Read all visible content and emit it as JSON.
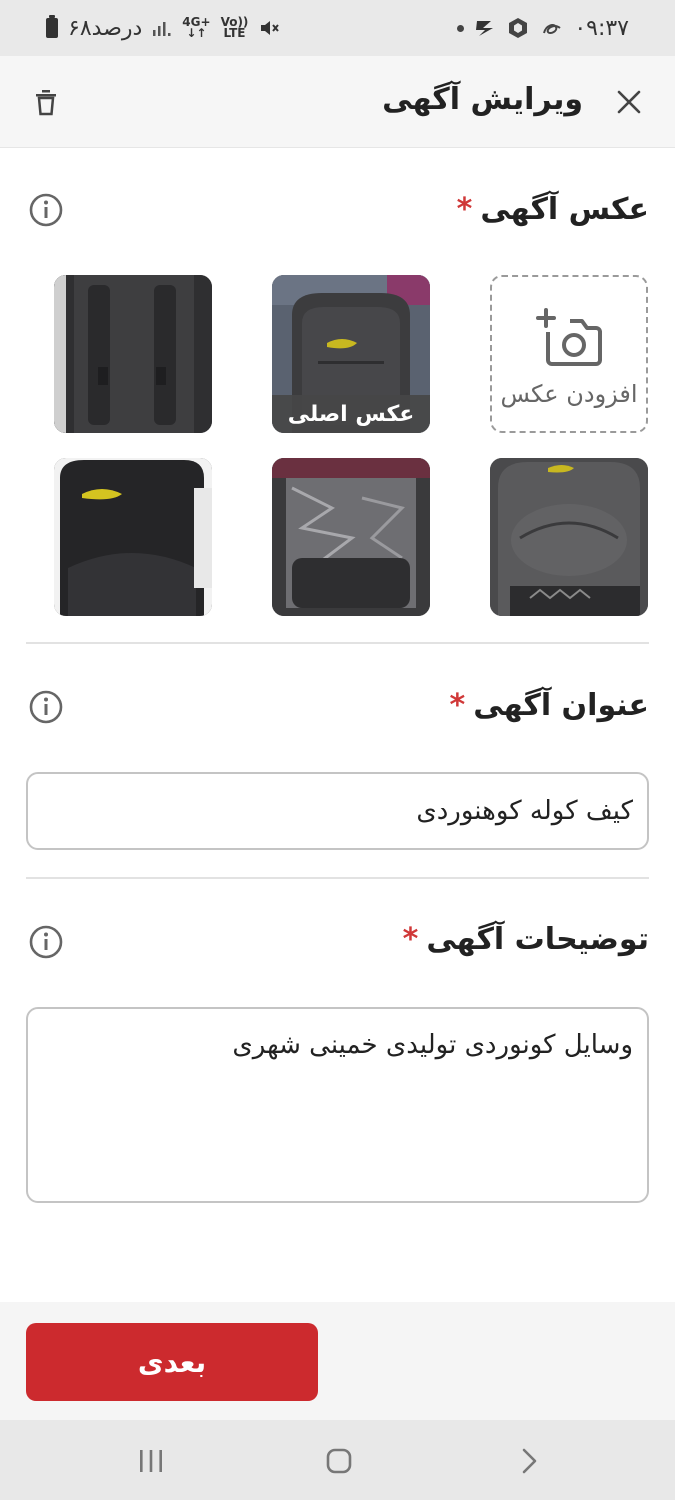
{
  "status_bar": {
    "time": "۰۹:۳۷",
    "battery_text": "۶۸درصد",
    "network_top": "4G+",
    "network_bottom": "↓↑",
    "volte_top": "Vo))",
    "volte_bottom": "LTE"
  },
  "app_bar": {
    "title": "ویرایش آگهی",
    "icons": [
      "close-icon",
      "trash-icon"
    ]
  },
  "photos_section": {
    "title": "عکس آگهی",
    "required_mark": "*",
    "add_photo_label": "افزودن عکس",
    "main_photo_badge": "عکس اصلی",
    "photo_count": 5
  },
  "title_section": {
    "title": "عنوان آگهی",
    "required_mark": "*",
    "value": "کیف کوله کوهنوردی"
  },
  "description_section": {
    "title": "توضیحات آگهی",
    "required_mark": "*",
    "value": "وسایل کونوردی تولیدی خمینی شهری"
  },
  "footer": {
    "next_label": "بعدی"
  },
  "colors": {
    "accent": "#cc2a2e",
    "required": "#d03838"
  }
}
